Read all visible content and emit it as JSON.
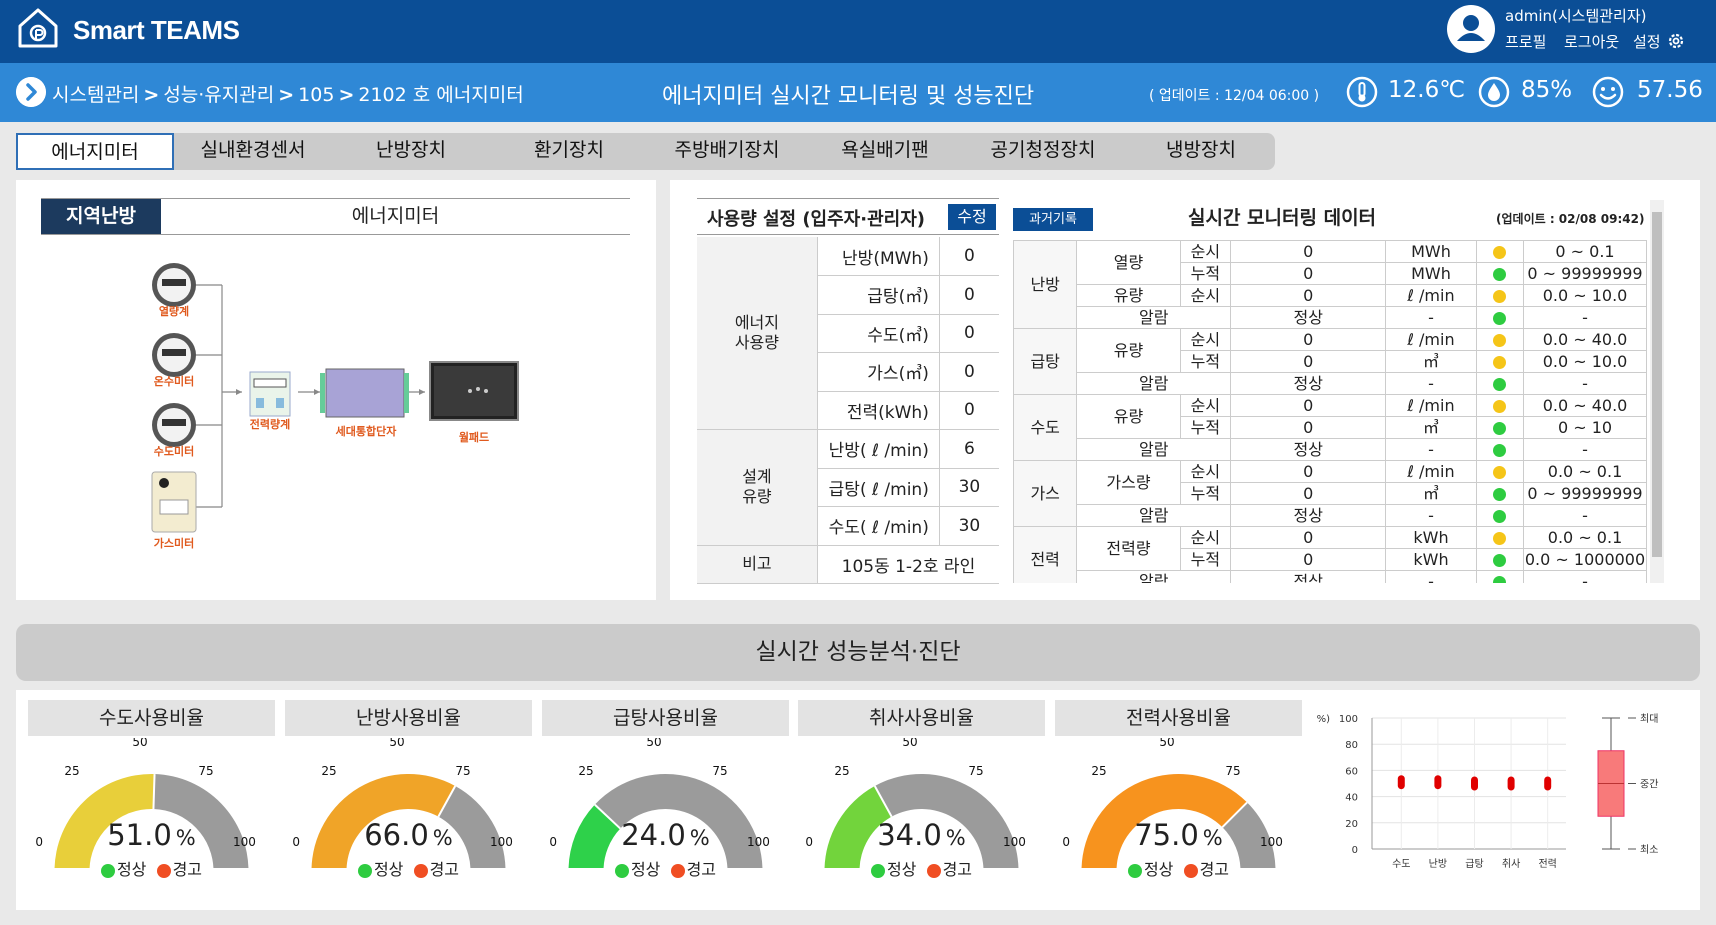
{
  "header": {
    "app_title": "Smart TEAMS",
    "user": "admin(시스템관리자)",
    "profile_link": "프로필",
    "logout_link": "로그아웃",
    "settings_link": "설정"
  },
  "subbar": {
    "breadcrumb": [
      "시스템관리",
      "성능·유지관리",
      "105",
      "2102 호 에너지미터"
    ],
    "title": "에너지미터 실시간 모니터링 및 성능진단",
    "updated": "( 업데이트 : 12/04 06:00 )",
    "temperature": "12.6℃",
    "humidity": "85%",
    "comfort": "57.56"
  },
  "tabs": [
    "에너지미터",
    "실내환경센서",
    "난방장치",
    "환기장치",
    "주방배기장치",
    "욕실배기팬",
    "공기청정장치",
    "냉방장치"
  ],
  "left_panel": {
    "tag": "지역난방",
    "title": "에너지미터",
    "diagram": {
      "meters": [
        "열량계",
        "온수미터",
        "수도미터",
        "가스미터"
      ],
      "power_meter": "전력량계",
      "terminal": "세대통합단자",
      "wallpad": "월패드"
    }
  },
  "usage": {
    "title": "사용량 설정 (입주자·관리자)",
    "edit_button": "수정",
    "group1": "에너지\n사용량",
    "group1_rows": [
      {
        "label": "난방(MWh)",
        "value": "0"
      },
      {
        "label": "급탕(㎥)",
        "value": "0"
      },
      {
        "label": "수도(㎥)",
        "value": "0"
      },
      {
        "label": "가스(㎥)",
        "value": "0"
      },
      {
        "label": "전력(kWh)",
        "value": "0"
      }
    ],
    "group2": "설계\n유량",
    "group2_rows": [
      {
        "label": "난방( ℓ /min)",
        "value": "6"
      },
      {
        "label": "급탕( ℓ /min)",
        "value": "30"
      },
      {
        "label": "수도( ℓ /min)",
        "value": "30"
      }
    ],
    "remark_label": "비고",
    "remark_value": "105동 1-2호 라인"
  },
  "monitoring": {
    "history_button": "과거기록",
    "title": "실시간 모니터링 데이터",
    "updated": "(업데이트 : 02/08 09:42)",
    "colors": {
      "warn": "#f5c518",
      "ok": "#2ecc40"
    },
    "rows": [
      {
        "g1": "난방",
        "g2": "열량",
        "g3": "순시",
        "value": "0",
        "unit": "MWh",
        "dot": "warn",
        "range": "0 ~ 0.1"
      },
      {
        "g3": "누적",
        "value": "0",
        "unit": "MWh",
        "dot": "ok",
        "range": "0 ~ 99999999"
      },
      {
        "g2": "유량",
        "g3": "순시",
        "value": "0",
        "unit": "ℓ /min",
        "dot": "warn",
        "range": "0.0 ~ 10.0"
      },
      {
        "g2": "알람",
        "value": "정상",
        "unit": "-",
        "dot": "ok",
        "range": "-"
      },
      {
        "g1": "급탕",
        "g2": "유량",
        "g3": "순시",
        "value": "0",
        "unit": "ℓ /min",
        "dot": "warn",
        "range": "0.0 ~ 40.0"
      },
      {
        "g3": "누적",
        "value": "0",
        "unit": "㎥",
        "dot": "warn",
        "range": "0.0 ~ 10.0"
      },
      {
        "g2": "알람",
        "value": "정상",
        "unit": "-",
        "dot": "ok",
        "range": "-"
      },
      {
        "g1": "수도",
        "g2": "유량",
        "g3": "순시",
        "value": "0",
        "unit": "ℓ /min",
        "dot": "warn",
        "range": "0.0 ~ 40.0"
      },
      {
        "g3": "누적",
        "value": "0",
        "unit": "㎥",
        "dot": "ok",
        "range": "0 ~ 10"
      },
      {
        "g2": "알람",
        "value": "정상",
        "unit": "-",
        "dot": "ok",
        "range": "-"
      },
      {
        "g1": "가스",
        "g2": "가스량",
        "g3": "순시",
        "value": "0",
        "unit": "ℓ /min",
        "dot": "warn",
        "range": "0.0 ~ 0.1"
      },
      {
        "g3": "누적",
        "value": "0",
        "unit": "㎥",
        "dot": "ok",
        "range": "0 ~ 99999999"
      },
      {
        "g2": "알람",
        "value": "정상",
        "unit": "-",
        "dot": "ok",
        "range": "-"
      },
      {
        "g1": "전력",
        "g2": "전력량",
        "g3": "순시",
        "value": "0",
        "unit": "kWh",
        "dot": "warn",
        "range": "0.0 ~ 0.1"
      },
      {
        "g3": "누적",
        "value": "0",
        "unit": "kWh",
        "dot": "ok",
        "range": "0.0 ~ 1000000"
      },
      {
        "g2": "알람",
        "value": "정상",
        "unit": "-",
        "dot": "ok",
        "range": "-"
      }
    ]
  },
  "analysis": {
    "banner": "실시간 성능분석·진단",
    "legend_ok": "정상",
    "legend_warn": "경고",
    "ok_color": "#2ecc40",
    "warn_color": "#f04e23",
    "gauges": [
      {
        "title": "수도사용비율",
        "value": 51.0,
        "display": "51.0",
        "color": "#e8cf3a"
      },
      {
        "title": "난방사용비율",
        "value": 66.0,
        "display": "66.0",
        "color": "#f0a428"
      },
      {
        "title": "급탕사용비율",
        "value": 24.0,
        "display": "24.0",
        "color": "#2ed14a"
      },
      {
        "title": "취사사용비율",
        "value": 34.0,
        "display": "34.0",
        "color": "#72d43c"
      },
      {
        "title": "전력사용비율",
        "value": 75.0,
        "display": "75.0",
        "color": "#f7931e"
      }
    ],
    "gauge_ticks": [
      "0",
      "25",
      "50",
      "75",
      "100"
    ],
    "gauge_unit": "%"
  },
  "chart_data": {
    "type": "scatter",
    "categories": [
      "수도",
      "난방",
      "급탕",
      "취사",
      "전력"
    ],
    "values": [
      51,
      51,
      50,
      50,
      50
    ],
    "ylabel": "(%)",
    "ylim": [
      0,
      100
    ],
    "yticks": [
      "0",
      "20",
      "40",
      "60",
      "80",
      "100"
    ],
    "grid": true,
    "point_color": "#e00000",
    "range_box": {
      "labels": [
        "최대",
        "중간",
        "최소"
      ],
      "low": 25,
      "high": 75,
      "color": "#f87a7a"
    }
  }
}
